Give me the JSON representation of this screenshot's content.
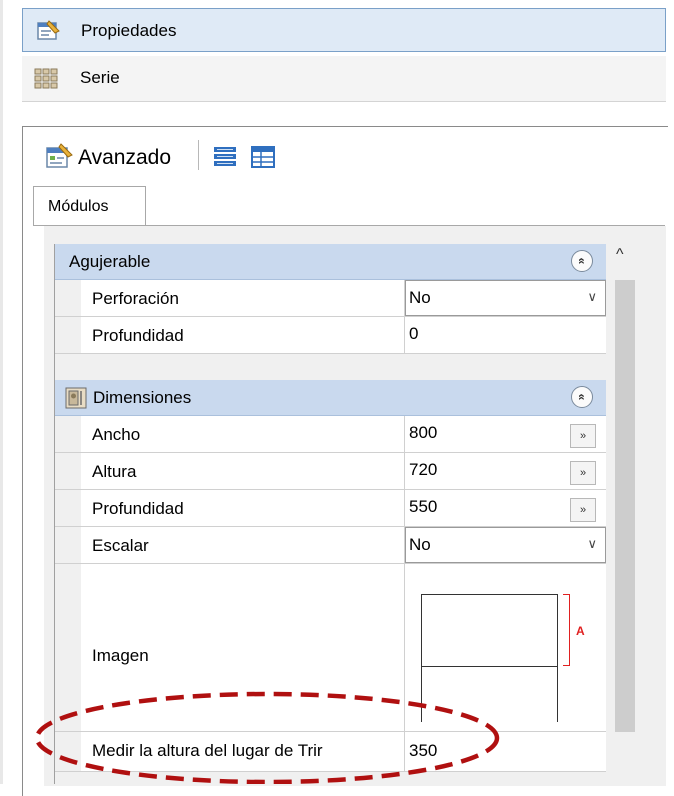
{
  "accordion": {
    "propiedades": "Propiedades",
    "serie": "Serie"
  },
  "toolbar": {
    "avanzado": "Avanzado"
  },
  "tabs": [
    "Módulos"
  ],
  "grid": {
    "agujerable": {
      "title": "Agujerable",
      "rows": [
        {
          "name": "Perforación",
          "value": "No"
        },
        {
          "name": "Profundidad",
          "value": "0"
        }
      ]
    },
    "dimensiones": {
      "title": "Dimensiones",
      "rows": [
        {
          "name": "Ancho",
          "value": "800"
        },
        {
          "name": "Altura",
          "value": "720"
        },
        {
          "name": "Profundidad",
          "value": "550"
        },
        {
          "name": "Escalar",
          "value": "No"
        },
        {
          "name": "Imagen",
          "value": ""
        },
        {
          "name": "Medir la altura del lugar de Trir",
          "value": "350"
        }
      ]
    }
  },
  "symbols": {
    "collapse": "«",
    "ellipsis": "»",
    "dropdown": "∨",
    "scroll_up": "^",
    "image_label": "A"
  },
  "colors": {
    "category_bg": "#c9d9ee",
    "selected_header_bg": "#dfeaf6",
    "highlight_ellipse": "#b01010",
    "dimension_marker": "#e02020"
  },
  "icons": {
    "propiedades": "properties-icon",
    "serie": "grid-icon",
    "avanzado": "advanced-properties-icon",
    "toolbar_1": "categorized-list-icon",
    "toolbar_2": "alphabetical-list-icon",
    "dimensiones": "cabinet-icon"
  }
}
